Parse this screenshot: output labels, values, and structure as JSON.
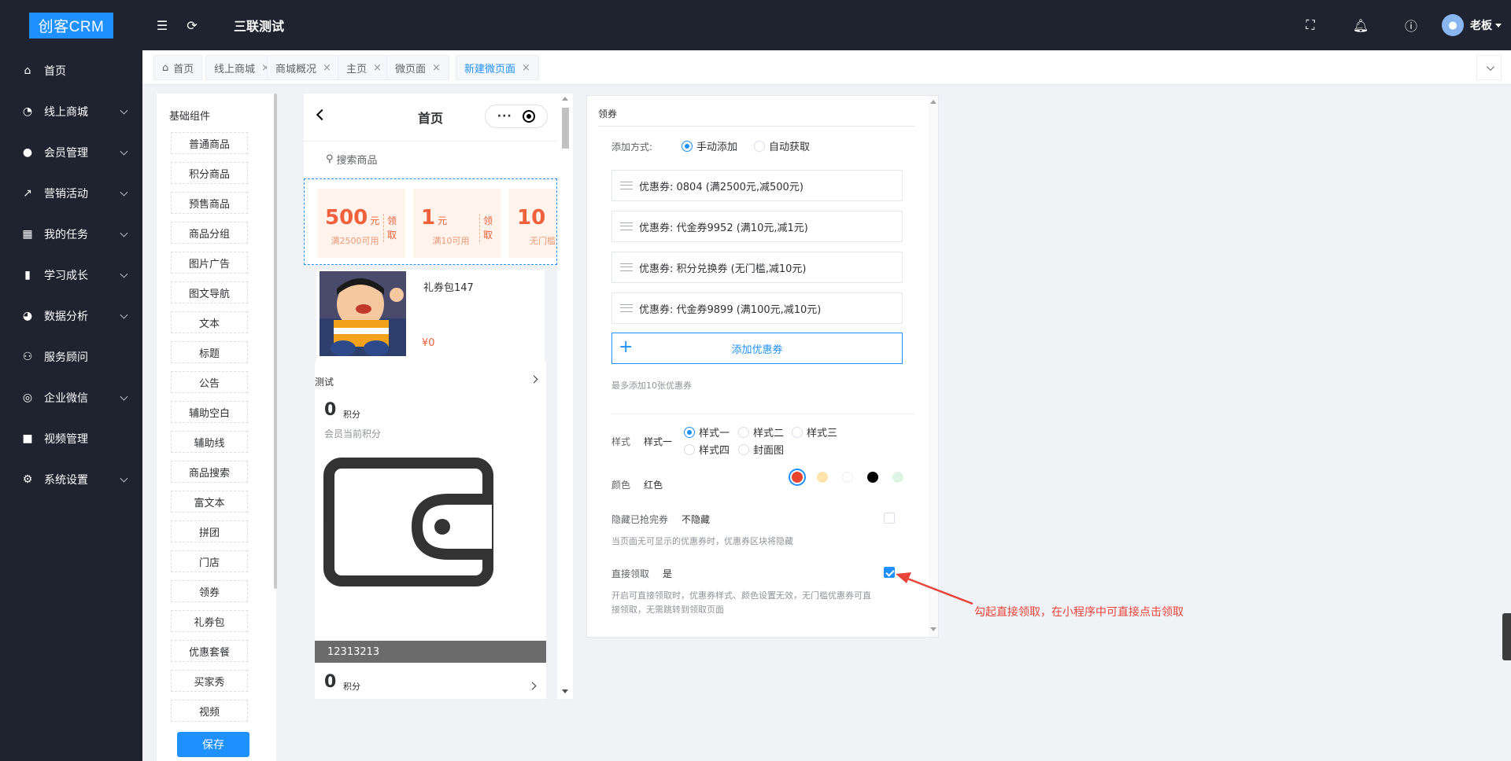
{
  "app": {
    "logo": "创客CRM",
    "title": "三联测试",
    "user": "老板"
  },
  "sidebar": {
    "items": [
      {
        "label": "首页",
        "icon": "home-icon",
        "sub": false
      },
      {
        "label": "线上商城",
        "icon": "mall-icon",
        "sub": true
      },
      {
        "label": "会员管理",
        "icon": "user-icon",
        "sub": true
      },
      {
        "label": "营销活动",
        "icon": "trend-icon",
        "sub": true
      },
      {
        "label": "我的任务",
        "icon": "grid-icon",
        "sub": true
      },
      {
        "label": "学习成长",
        "icon": "book-icon",
        "sub": true
      },
      {
        "label": "数据分析",
        "icon": "pie-icon",
        "sub": true
      },
      {
        "label": "服务顾问",
        "icon": "group-icon",
        "sub": false
      },
      {
        "label": "企业微信",
        "icon": "wechat-icon",
        "sub": true
      },
      {
        "label": "视频管理",
        "icon": "video-icon",
        "sub": false
      },
      {
        "label": "系统设置",
        "icon": "gear-icon",
        "sub": true
      }
    ]
  },
  "tabs": [
    {
      "label": "首页",
      "home": true,
      "closable": false,
      "active": false
    },
    {
      "label": "线上商城",
      "closable": true,
      "active": false
    },
    {
      "label": "商城概况",
      "closable": true,
      "active": false
    },
    {
      "label": "主页",
      "closable": true,
      "active": false
    },
    {
      "label": "微页面",
      "closable": true,
      "active": false
    },
    {
      "label": "新建微页面",
      "closable": true,
      "active": true
    }
  ],
  "library": {
    "title": "基础组件",
    "items": [
      "普通商品",
      "积分商品",
      "预售商品",
      "商品分组",
      "图片广告",
      "图文导航",
      "文本",
      "标题",
      "公告",
      "辅助空白",
      "辅助线",
      "商品搜索",
      "富文本",
      "拼团",
      "门店",
      "领券",
      "礼券包",
      "优惠套餐",
      "买家秀",
      "视频"
    ],
    "save": "保存"
  },
  "phone": {
    "title": "首页",
    "search_placeholder": "搜索商品",
    "coupons": [
      {
        "amount": "500",
        "unit": "元",
        "cond": "满2500可用",
        "get": "领取"
      },
      {
        "amount": "1",
        "unit": "元",
        "cond": "满10可用",
        "get": "领取"
      },
      {
        "amount": "10",
        "unit": "",
        "cond": "无门槛使",
        "get": ""
      }
    ],
    "gift": {
      "name": "礼券包147",
      "price": "¥0"
    },
    "points": {
      "title": "测试",
      "value": "0",
      "unit": "积分",
      "sub": "会员当前积分",
      "wallet_label": "12313213",
      "value2": "0",
      "unit2": "积分"
    }
  },
  "panel": {
    "title": "领券",
    "add_mode_label": "添加方式:",
    "add_modes": [
      {
        "label": "手动添加",
        "checked": true
      },
      {
        "label": "自动获取",
        "checked": false
      }
    ],
    "coupons": [
      "优惠券: 0804 (满2500元,减500元)",
      "优惠券: 代金券9952 (满10元,减1元)",
      "优惠券: 积分兑换券 (无门槛,减10元)",
      "优惠券: 代金券9899 (满100元,减10元)"
    ],
    "add_coupon": "添加优惠券",
    "max_hint": "最多添加10张优惠券",
    "style_label": "样式",
    "style_value": "样式一",
    "styles": [
      {
        "label": "样式一",
        "checked": true
      },
      {
        "label": "样式二",
        "checked": false
      },
      {
        "label": "样式三",
        "checked": false
      },
      {
        "label": "样式四",
        "checked": false
      },
      {
        "label": "封面图",
        "checked": false
      }
    ],
    "color_label": "颜色",
    "color_value": "红色",
    "colors": [
      "#e8442f",
      "#ffe3ad",
      "#ffffff",
      "#000000",
      "#dff5e3"
    ],
    "hide_label": "隐藏已抢完券",
    "hide_value": "不隐藏",
    "hide_hint": "当页面无可显示的优惠券时，优惠券区块将隐藏",
    "direct_label": "直接领取",
    "direct_value": "是",
    "direct_hint_1": "开启可直接领取时，优惠券样式、颜色设置无效，无门槛优惠券可直",
    "direct_hint_2": "接领取，无需跳转到领取页面"
  },
  "annotation": "勾起直接领取，在小程序中可直接点击领取",
  "colors": {
    "accent": "#1e90ff",
    "sidebar_bg": "#1f2330",
    "annotation": "#e8443a"
  }
}
